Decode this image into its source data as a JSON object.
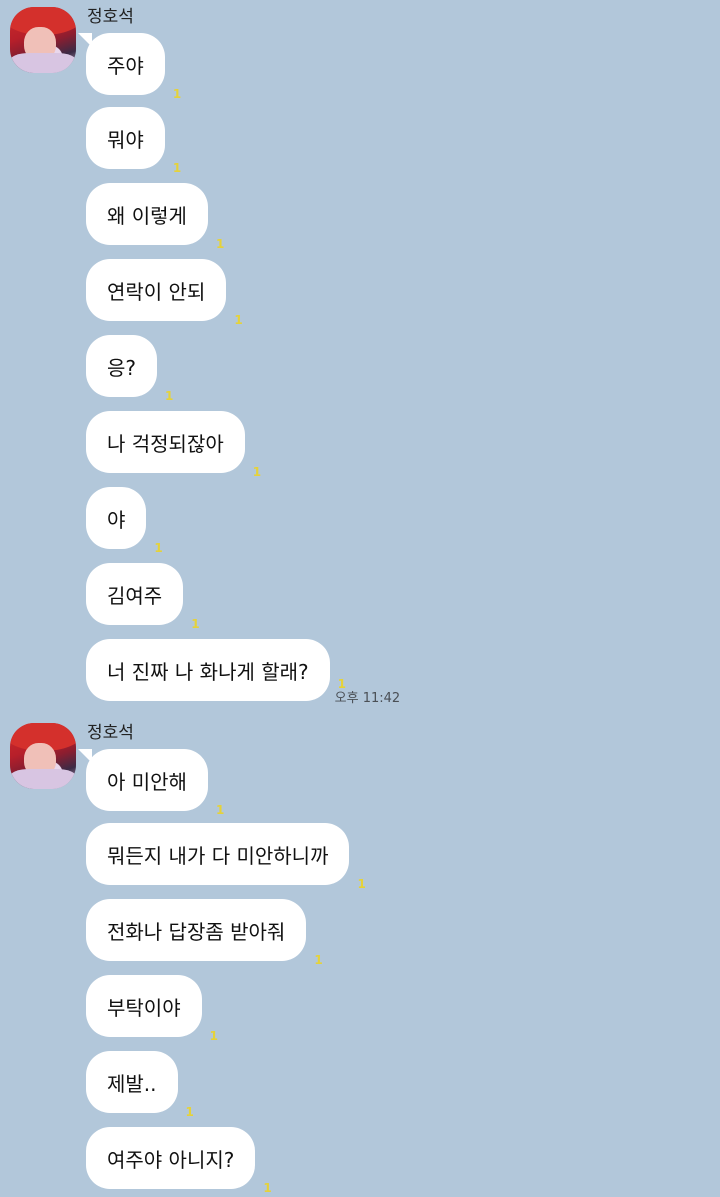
{
  "groups": [
    {
      "sender": "정호석",
      "messages": [
        {
          "text": "주야",
          "unread": "1"
        },
        {
          "text": "뭐야",
          "unread": "1"
        },
        {
          "text": "왜 이렇게",
          "unread": "1"
        },
        {
          "text": "연락이 안되",
          "unread": "1"
        },
        {
          "text": "응?",
          "unread": "1"
        },
        {
          "text": "나 걱정되잖아",
          "unread": "1"
        },
        {
          "text": "야",
          "unread": "1"
        },
        {
          "text": "김여주",
          "unread": "1"
        },
        {
          "text": "너 진짜 나 화나게 할래?",
          "unread": "1",
          "time": "오후 11:42"
        }
      ]
    },
    {
      "sender": "정호석",
      "messages": [
        {
          "text": "아 미안해",
          "unread": "1"
        },
        {
          "text": "뭐든지 내가 다 미안하니까",
          "unread": "1"
        },
        {
          "text": "전화나 답장좀 받아줘",
          "unread": "1"
        },
        {
          "text": "부탁이야",
          "unread": "1"
        },
        {
          "text": "제발..",
          "unread": "1"
        },
        {
          "text": "여주야 아니지?",
          "unread": "1"
        }
      ]
    }
  ],
  "colors": {
    "background": "#b2c7da",
    "bubble": "#ffffff",
    "unread": "#e5d23a"
  }
}
